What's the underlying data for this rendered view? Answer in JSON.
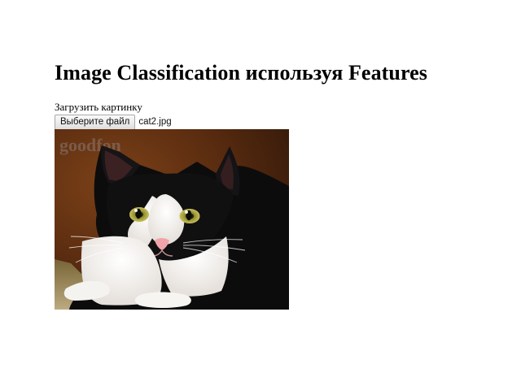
{
  "header": {
    "title": "Image Classification используя Features"
  },
  "upload": {
    "label": "Загрузить картинку",
    "button_label": "Выберите файл",
    "file_name": "cat2.jpg"
  },
  "preview": {
    "subject_icon": "cat-photo",
    "watermark": "goodfon"
  }
}
